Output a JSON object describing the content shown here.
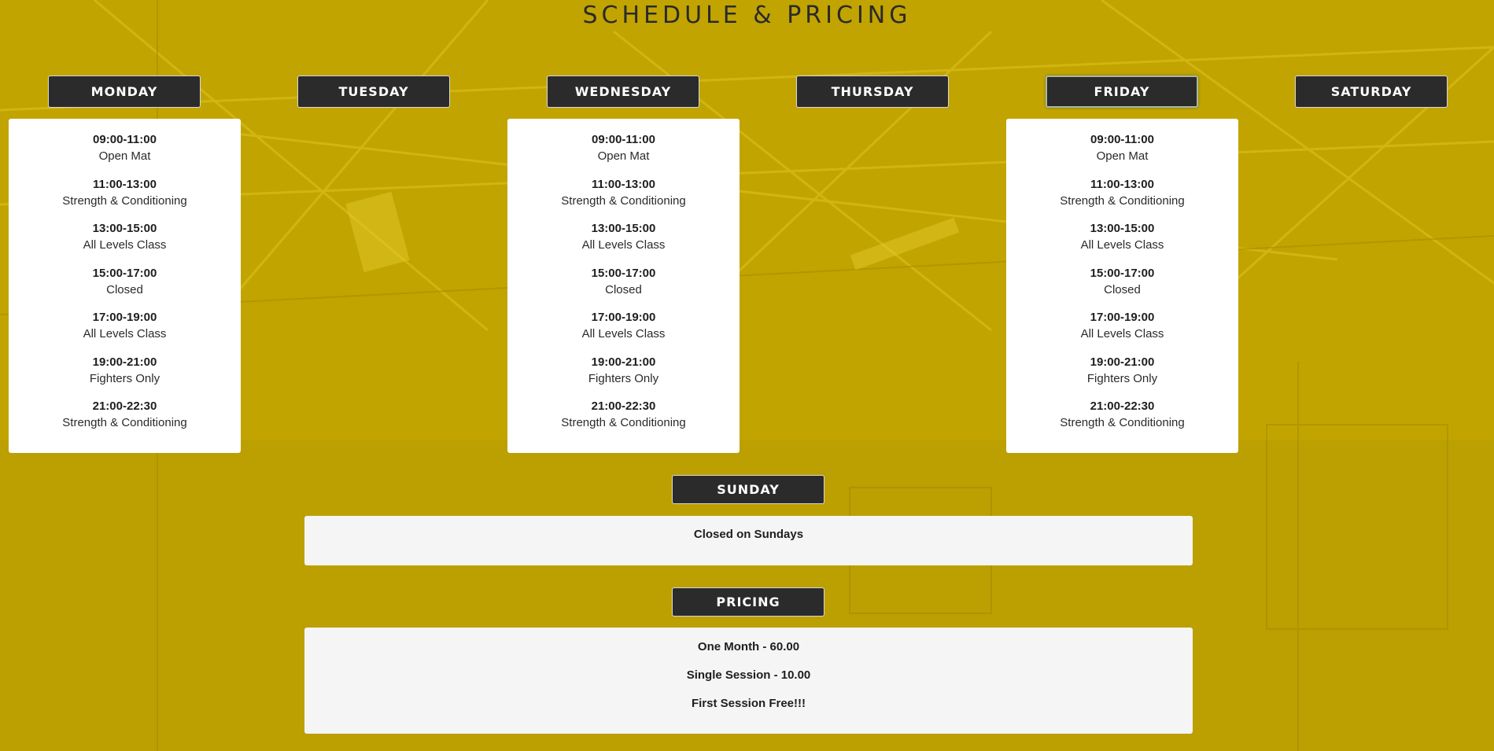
{
  "page_title": "SCHEDULE & PRICING",
  "colors": {
    "background": "#c2a400",
    "tab_bg": "#2b2b2b",
    "card_bg": "#ffffff",
    "panel_bg": "#f5f5f5"
  },
  "days": [
    {
      "label": "MONDAY"
    },
    {
      "label": "TUESDAY"
    },
    {
      "label": "WEDNESDAY"
    },
    {
      "label": "THURSDAY"
    },
    {
      "label": "FRIDAY"
    },
    {
      "label": "SATURDAY"
    }
  ],
  "schedules": {
    "monday": [
      {
        "time": "09:00-11:00",
        "name": "Open Mat"
      },
      {
        "time": "11:00-13:00",
        "name": "Strength & Conditioning"
      },
      {
        "time": "13:00-15:00",
        "name": "All Levels Class"
      },
      {
        "time": "15:00-17:00",
        "name": "Closed"
      },
      {
        "time": "17:00-19:00",
        "name": "All Levels Class"
      },
      {
        "time": "19:00-21:00",
        "name": "Fighters Only"
      },
      {
        "time": "21:00-22:30",
        "name": "Strength & Conditioning"
      }
    ],
    "wednesday": [
      {
        "time": "09:00-11:00",
        "name": "Open Mat"
      },
      {
        "time": "11:00-13:00",
        "name": "Strength & Conditioning"
      },
      {
        "time": "13:00-15:00",
        "name": "All Levels Class"
      },
      {
        "time": "15:00-17:00",
        "name": "Closed"
      },
      {
        "time": "17:00-19:00",
        "name": "All Levels Class"
      },
      {
        "time": "19:00-21:00",
        "name": "Fighters Only"
      },
      {
        "time": "21:00-22:30",
        "name": "Strength & Conditioning"
      }
    ],
    "friday": [
      {
        "time": "09:00-11:00",
        "name": "Open Mat"
      },
      {
        "time": "11:00-13:00",
        "name": "Strength & Conditioning"
      },
      {
        "time": "13:00-15:00",
        "name": "All Levels Class"
      },
      {
        "time": "15:00-17:00",
        "name": "Closed"
      },
      {
        "time": "17:00-19:00",
        "name": "All Levels Class"
      },
      {
        "time": "19:00-21:00",
        "name": "Fighters Only"
      },
      {
        "time": "21:00-22:30",
        "name": "Strength & Conditioning"
      }
    ]
  },
  "sunday": {
    "label": "SUNDAY",
    "text": "Closed on Sundays"
  },
  "pricing": {
    "label": "PRICING",
    "items": [
      "One Month - 60.00",
      "Single Session - 10.00",
      "First Session Free!!!"
    ]
  }
}
